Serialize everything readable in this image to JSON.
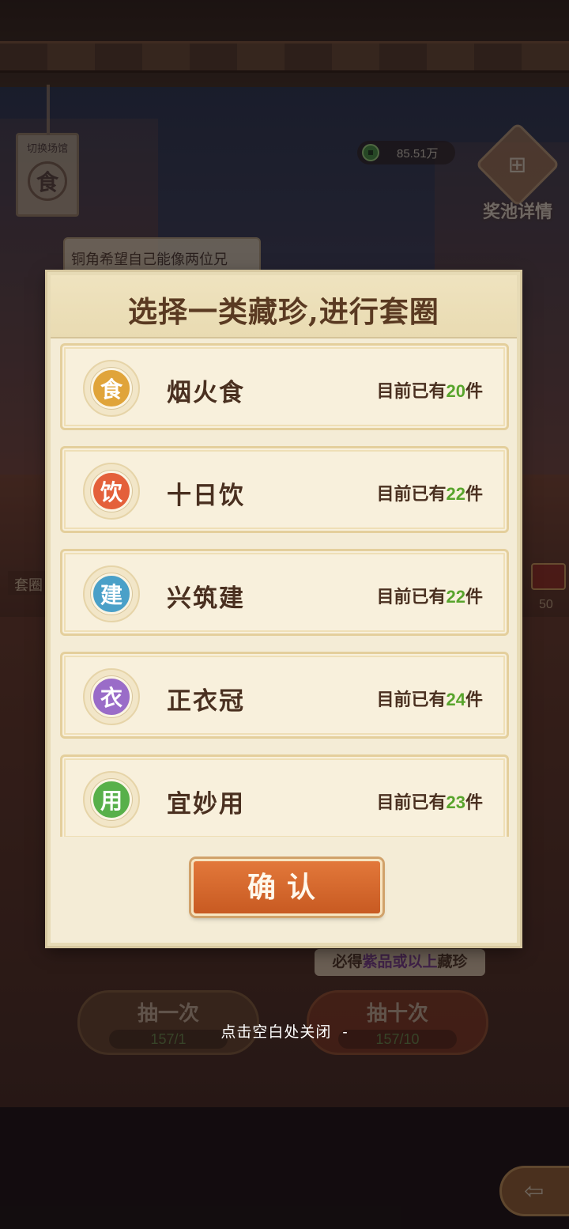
{
  "background": {
    "switch_venue_label": "切换场馆",
    "switch_venue_glyph": "食",
    "coin_value": "85.51万",
    "prize_pool_label": "奖池详情",
    "speech_text": "铜角希望自己能像两位兄",
    "side_label": "套圈",
    "chest_count": "50",
    "guarantee_prefix": "必得",
    "guarantee_highlight": "紫品或以上",
    "guarantee_suffix": "藏珍",
    "draw_once_label": "抽一次",
    "draw_once_cost": "157/1",
    "draw_ten_label": "抽十次",
    "draw_ten_cost": "157/10",
    "close_hint": "点击空白处关闭"
  },
  "dialog": {
    "title": "选择一类藏珍,进行套圈",
    "count_prefix": "目前已有",
    "count_suffix": "件",
    "categories": [
      {
        "glyph": "食",
        "name": "烟火食",
        "count": "20",
        "color": "#e0a43a"
      },
      {
        "glyph": "饮",
        "name": "十日饮",
        "count": "22",
        "color": "#e4603a"
      },
      {
        "glyph": "建",
        "name": "兴筑建",
        "count": "22",
        "color": "#4aa0c8"
      },
      {
        "glyph": "衣",
        "name": "正衣冠",
        "count": "24",
        "color": "#9a6cc8"
      },
      {
        "glyph": "用",
        "name": "宜妙用",
        "count": "23",
        "color": "#58b04a"
      }
    ],
    "confirm_label": "确认"
  },
  "colors": {
    "accent": "#d9692e",
    "count_green": "#58a42c",
    "title_brown": "#5a3a22"
  }
}
